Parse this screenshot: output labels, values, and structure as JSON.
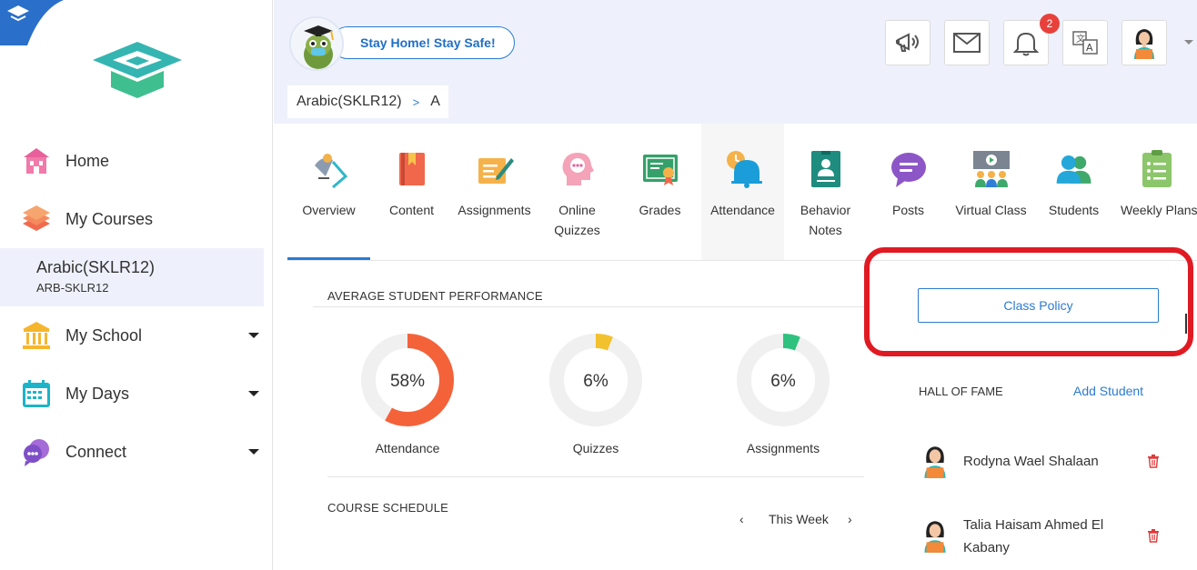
{
  "sidebar": {
    "nav": [
      {
        "label": "Home",
        "icon": "home-icon"
      },
      {
        "label": "My Courses",
        "icon": "courses-icon"
      },
      {
        "label": "My School",
        "icon": "school-icon"
      },
      {
        "label": "My Days",
        "icon": "calendar-icon"
      },
      {
        "label": "Connect",
        "icon": "connect-icon"
      }
    ],
    "active_course": {
      "name": "Arabic(SKLR12)",
      "code": "ARB-SKLR12"
    }
  },
  "header": {
    "banner": "Stay Home! Stay Safe!",
    "notification_count": "2",
    "icons": [
      "announcement-icon",
      "mail-icon",
      "bell-icon",
      "translate-icon",
      "profile-avatar"
    ]
  },
  "breadcrumb": {
    "course": "Arabic(SKLR12)",
    "separator": ">",
    "section": "A"
  },
  "tabs": [
    {
      "label": "Overview"
    },
    {
      "label": "Content"
    },
    {
      "label": "Assignments"
    },
    {
      "label": "Online Quizzes"
    },
    {
      "label": "Grades"
    },
    {
      "label": "Attendance"
    },
    {
      "label": "Behavior Notes"
    },
    {
      "label": "Posts"
    },
    {
      "label": "Virtual Class"
    },
    {
      "label": "Students"
    },
    {
      "label": "Weekly Plans"
    }
  ],
  "performance": {
    "title": "AVERAGE STUDENT PERFORMANCE",
    "metrics": [
      {
        "label": "Attendance",
        "value_text": "58%",
        "value": 58,
        "color": "#f4623a"
      },
      {
        "label": "Quizzes",
        "value_text": "6%",
        "value": 6,
        "color": "#f2c12e"
      },
      {
        "label": "Assignments",
        "value_text": "6%",
        "value": 6,
        "color": "#2ec27e"
      }
    ]
  },
  "schedule": {
    "title": "COURSE SCHEDULE",
    "period": "This Week",
    "prev": "‹",
    "next": "›"
  },
  "right_panel": {
    "class_policy": "Class Policy",
    "hall_of_fame": "HALL OF FAME",
    "add_student": "Add Student",
    "students": [
      {
        "line1": "Rodyna Wael Shalaan",
        "line2": ""
      },
      {
        "line1": "Talia Haisam Ahmed El",
        "line2": "Kabany"
      }
    ]
  },
  "colors": {
    "accent": "#2b7bd1",
    "highlight_red": "#e01a22",
    "nav_bg": "#eef1fb"
  }
}
